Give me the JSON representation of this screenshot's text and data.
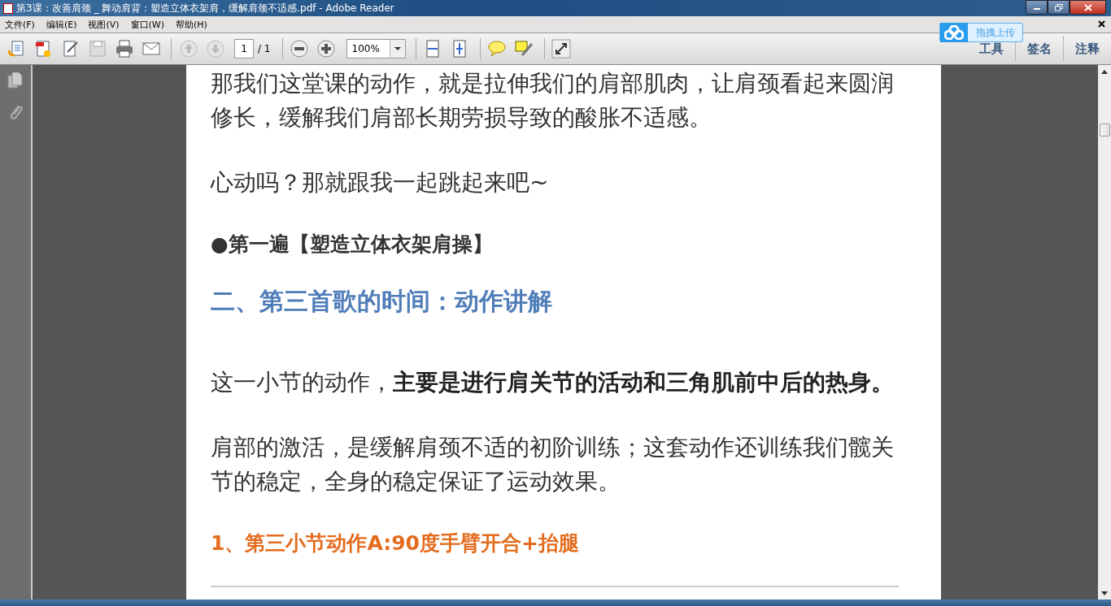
{
  "window": {
    "title": "第3课：改善肩颈 _ 舞动肩背：塑造立体衣架肩，缓解肩颈不适感.pdf - Adobe Reader"
  },
  "menu": [
    "文件(F)",
    "编辑(E)",
    "视图(V)",
    "窗口(W)",
    "帮助(H)"
  ],
  "toolbar": {
    "page_field": "1",
    "page_total": "/ 1",
    "zoom": "100%"
  },
  "side_links": [
    "工具",
    "签名",
    "注释"
  ],
  "upload_widget": {
    "label": "拖拽上传"
  },
  "document": [
    {
      "kind": "text",
      "text": "那我们这堂课的动作，就是拉伸我们的肩部肌肉，让肩颈看起来圆润修长，缓解我们肩部长期劳损导致的酸胀不适感。"
    },
    {
      "kind": "text",
      "text": "心动吗？那就跟我一起跳起来吧~"
    },
    {
      "kind": "bullet",
      "text": "●第一遍【塑造立体衣架肩操】"
    },
    {
      "kind": "heading",
      "text": "二、第三首歌的时间：动作讲解"
    },
    {
      "kind": "text",
      "text": "这一小节的动作，**主要是进行肩关节的活动和三角肌前中后的热身。**"
    },
    {
      "kind": "text",
      "text": "肩部的激活，是缓解肩颈不适的初阶训练；这套动作还训练我们髋关节的稳定，全身的稳定保证了运动效果。"
    },
    {
      "kind": "subheading",
      "text": "1、第三小节动作A:90度手臂开合+抬腿"
    }
  ]
}
